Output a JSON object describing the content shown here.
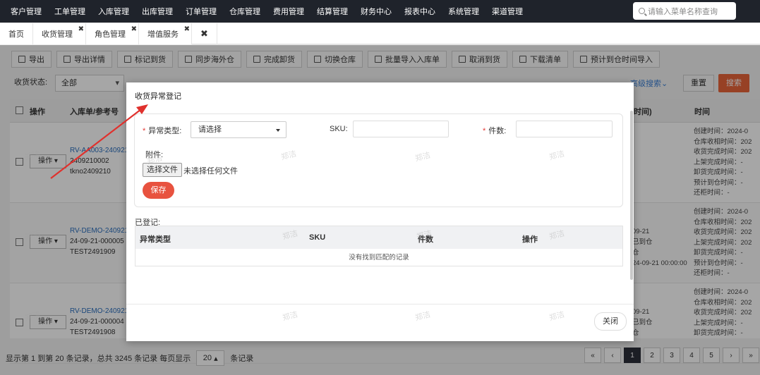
{
  "nav": {
    "items": [
      "客户管理",
      "工单管理",
      "入库管理",
      "出库管理",
      "订单管理",
      "仓库管理",
      "费用管理",
      "结算管理",
      "财务中心",
      "报表中心",
      "系统管理",
      "渠道管理"
    ],
    "search_placeholder": "请输入菜单名称查询"
  },
  "tabs": [
    {
      "label": "首页",
      "closable": false
    },
    {
      "label": "收货管理",
      "closable": true
    },
    {
      "label": "角色管理",
      "closable": true
    },
    {
      "label": "增值服务",
      "closable": true
    }
  ],
  "toolbar": [
    "导出",
    "导出详情",
    "标记到货",
    "同步海外仓",
    "完成卸货",
    "切换仓库",
    "批量导入入库单",
    "取消到货",
    "下载清单",
    "预计到仓时间导入"
  ],
  "filter": {
    "status_label": "收货状态:",
    "status_value": "全部",
    "advanced": "高级搜索",
    "reset": "重置",
    "search": "搜索"
  },
  "grid": {
    "headers": {
      "op": "操作",
      "ref": "入库单/参考号",
      "time_short": "时间)",
      "time": "时间"
    },
    "op_label": "操作",
    "rows": [
      {
        "ref1": "RV-AA003-240921",
        "ref2": "2409210002",
        "ref3": "tkno2409210",
        "mid": [],
        "times": [
          "创建时间：2024-0",
          "仓库收相时间：202",
          "收货完成时间：202",
          "上架完成时间：-",
          "卸货完成时间：-",
          "预计到仓时间：-",
          "还柜时间：-"
        ]
      },
      {
        "ref1": "RV-DEMO-240921",
        "ref2": "24-09-21-000005",
        "ref3": "TEST2491909",
        "mid": [
          "09-21",
          "已到仓",
          "仓",
          "24-09-21 00:00:00"
        ],
        "times": [
          "创建时间：2024-0",
          "仓库收相时间：202",
          "收货完成时间：202",
          "上架完成时间：202",
          "卸货完成时间：-",
          "预计到仓时间：-",
          "还柜时间：-"
        ]
      },
      {
        "ref1": "RV-DEMO-240921",
        "ref2": "24-09-21-000004",
        "ref3": "TEST2491908",
        "mid": [
          "09-21",
          "已到仓",
          "仓"
        ],
        "times": [
          "创建时间：2024-0",
          "仓库收相时间：202",
          "收货完成时间：202",
          "上架完成时间：-",
          "卸货完成时间：-"
        ]
      }
    ]
  },
  "pager": {
    "info": "显示第 1 到第 20 条记录，总共 3245 条记录 每页显示",
    "size": "20",
    "suffix": "条记录",
    "pages": [
      "«",
      "‹",
      "1",
      "2",
      "3",
      "4",
      "5",
      "›",
      "»"
    ],
    "active": "1"
  },
  "modal": {
    "title": "收货异常登记",
    "type_label": "异常类型:",
    "type_value": "请选择",
    "sku_label": "SKU:",
    "qty_label": "件数:",
    "attach_label": "附件:",
    "file_button": "选择文件",
    "file_info": "未选择任何文件",
    "save": "保存",
    "registered_label": "已登记:",
    "table_headers": [
      "异常类型",
      "SKU",
      "件数",
      "操作"
    ],
    "empty_text": "没有找到匹配的记录",
    "close": "关闭"
  },
  "watermark": "郑洁",
  "colors": {
    "nav_bg": "#1f232b",
    "accent": "#e8643a",
    "save": "#e8523f",
    "link": "#2a6ebd",
    "arrow": "#e0312d"
  }
}
